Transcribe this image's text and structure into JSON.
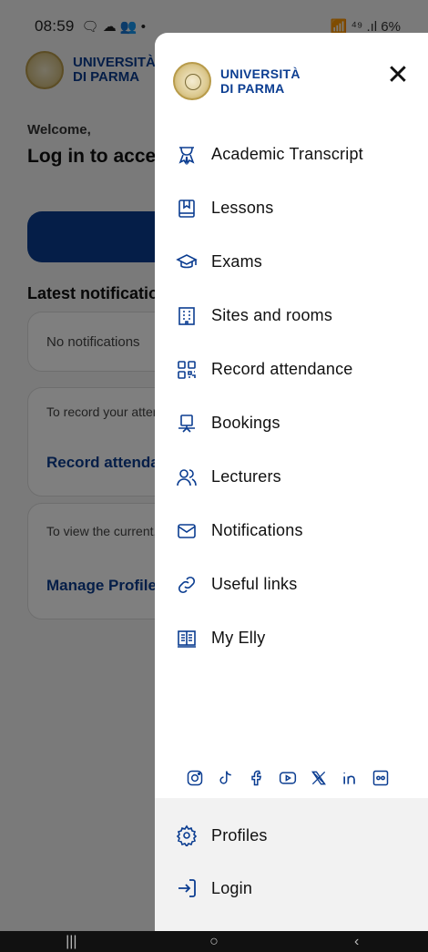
{
  "status_bar": {
    "time": "08:59",
    "indicators": "🗨 ☁ 👥 •",
    "right": "📶 ⁴⁹ .ıl 6%",
    "battery_color": "#d33333"
  },
  "background": {
    "university_name_line1": "UNIVERSITÀ",
    "university_name_line2": "DI PARMA",
    "welcome": "Welcome,",
    "title": "Log in to access the App",
    "latest_notifications": "Latest notifications",
    "card1_text": "No notifications",
    "card2_text": "To record your attendance, access the following",
    "card2_link": "Record attendance",
    "card3_text": "To view the current, define at least",
    "card3_link": "Manage Profiles"
  },
  "drawer": {
    "logo_line1": "UNIVERSITÀ",
    "logo_line2": "DI PARMA",
    "close_label": "✕",
    "menu": [
      {
        "label": "Academic Transcript",
        "icon": "award-icon"
      },
      {
        "label": "Lessons",
        "icon": "book-icon"
      },
      {
        "label": "Exams",
        "icon": "graduation-cap-icon"
      },
      {
        "label": "Sites and rooms",
        "icon": "building-icon"
      },
      {
        "label": "Record attendance",
        "icon": "qr-code-icon"
      },
      {
        "label": "Bookings",
        "icon": "desk-bell-icon"
      },
      {
        "label": "Lecturers",
        "icon": "users-icon"
      },
      {
        "label": "Notifications",
        "icon": "mail-icon"
      },
      {
        "label": "Useful links",
        "icon": "link-icon"
      },
      {
        "label": "My Elly",
        "icon": "open-book-icon"
      }
    ],
    "socials": [
      "instagram-icon",
      "tiktok-icon",
      "facebook-icon",
      "youtube-icon",
      "x-icon",
      "linkedin-icon",
      "flickr-icon"
    ],
    "bottom": [
      {
        "label": "Profiles",
        "icon": "gear-icon"
      },
      {
        "label": "Login",
        "icon": "login-icon"
      }
    ]
  },
  "accent_color": "#0b3d91",
  "nav_bar": {
    "recents": "|||",
    "home": "○",
    "back": "‹"
  }
}
